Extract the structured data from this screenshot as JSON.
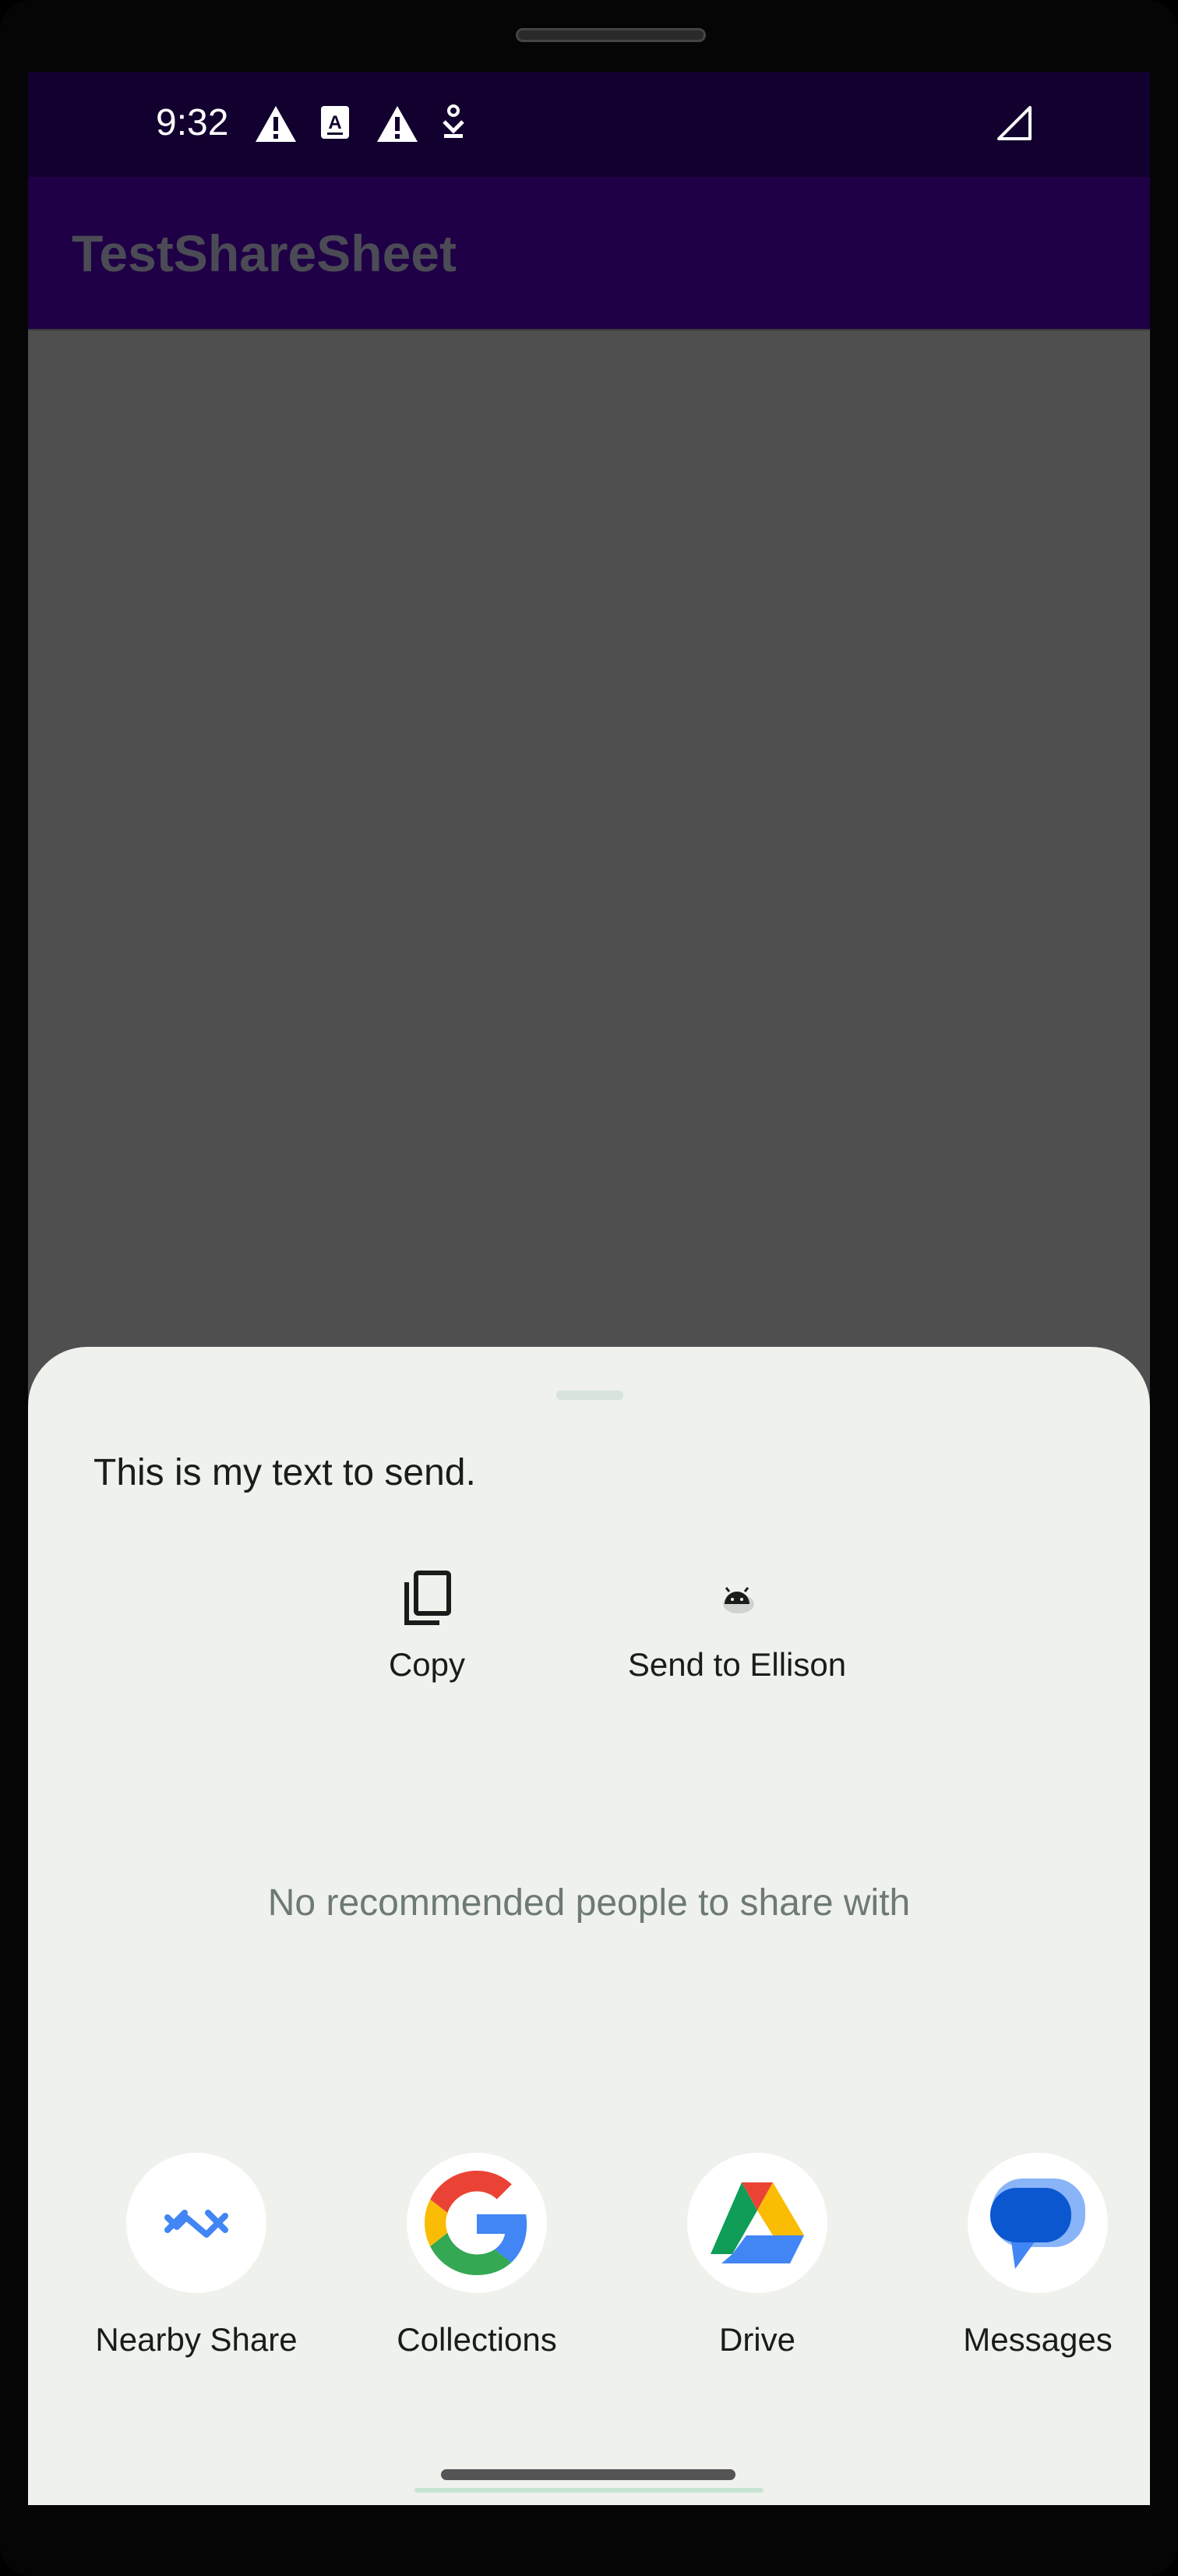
{
  "status_bar": {
    "time": "9:32",
    "icons": [
      "warning-icon",
      "a-box-icon",
      "warning-icon",
      "download-icon",
      "signal-icon"
    ]
  },
  "app_bar": {
    "title": "TestShareSheet"
  },
  "share_sheet": {
    "text": "This is my text to send.",
    "actions": [
      {
        "label": "Copy",
        "icon": "copy-icon"
      },
      {
        "label": "Send to Ellison",
        "icon": "android-icon"
      }
    ],
    "no_people": "No recommended people to share with",
    "apps": [
      {
        "label": "Nearby Share",
        "icon": "nearby-share-icon"
      },
      {
        "label": "Collections",
        "icon": "google-icon"
      },
      {
        "label": "Drive",
        "icon": "drive-icon"
      },
      {
        "label": "Messages",
        "icon": "messages-icon"
      }
    ]
  },
  "colors": {
    "status_bar": "#12002e",
    "app_bar": "#1f0046",
    "sheet_bg": "#eff1ed",
    "scrim": "#4f4f4f"
  }
}
